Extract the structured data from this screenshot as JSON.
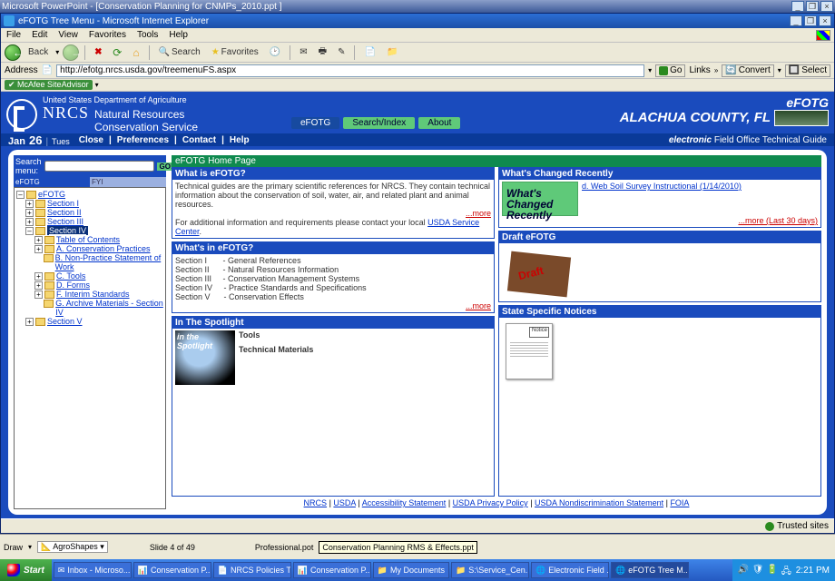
{
  "ppt_title": "Microsoft PowerPoint - [Conservation Planning for CNMPs_2010.ppt ]",
  "ie_title": "eFOTG Tree Menu - Microsoft Internet Explorer",
  "menu": [
    "File",
    "Edit",
    "View",
    "Favorites",
    "Tools",
    "Help"
  ],
  "tb": {
    "back": "Back",
    "search": "Search",
    "favorites": "Favorites"
  },
  "addr_label": "Address",
  "url": "http://efotg.nrcs.usda.gov/treemenuFS.aspx",
  "go": "Go",
  "links": "Links",
  "convert": "Convert",
  "select": "Select",
  "mcafee": "McAfee SiteAdvisor",
  "usda_line": "United States Department of Agriculture",
  "nrcs": "NRCS",
  "nrcs_sub1": "Natural Resources",
  "nrcs_sub2": "Conservation Service",
  "county": "ALACHUA COUNTY, FL",
  "efotg": "eFOTG",
  "subtitle_em": "electronic",
  "subtitle_rest": " Field Office Technical Guide",
  "month": "Jan",
  "day": "26",
  "dow": "Tues",
  "applinks": {
    "close": "Close",
    "prefs": "Preferences",
    "contact": "Contact",
    "help": "Help"
  },
  "tabs": {
    "efotg": "eFOTG",
    "search": "Search/Index",
    "about": "About"
  },
  "search_label": "Search menu:",
  "search_go": "GO!",
  "side_tabs": {
    "efotg": "eFOTG",
    "fyi": "FYI"
  },
  "tree": {
    "root": "eFOTG",
    "s1": "Section I",
    "s2": "Section II",
    "s3": "Section III",
    "s4": "Section IV",
    "toc": "Table of Contents",
    "a": "A. Conservation Practices",
    "b": "B. Non-Practice Statement of Work",
    "c": "C. Tools",
    "d": "D. Forms",
    "f": "F. Interim Standards",
    "g": "G. Archive Materials - Section IV",
    "s5": "Section V"
  },
  "page_title": "eFOTG Home Page",
  "what_is_h": "What is eFOTG?",
  "what_is_p1": "Technical guides are the primary scientific references for NRCS. They contain technical information about the conservation of soil, water, air, and related plant and animal resources.",
  "more": "...more",
  "what_is_p2a": "For additional information and requirements please contact your local ",
  "service_center": "USDA Service Center",
  "in_efotg_h": "What's in eFOTG?",
  "sections": {
    "s1": "Section I       - General References",
    "s2": "Section II      - Natural Resources Information",
    "s3": "Section III     - Conservation Management Systems",
    "s4": "Section IV     - Practice Standards and Specifications",
    "s5": "Section V      - Conservation Effects"
  },
  "spotlight_h": "In The Spotlight",
  "spot_tools": "Tools",
  "spot_tech": "Technical Materials",
  "changed_h": "What's Changed Recently",
  "changed_img1": "What's",
  "changed_img2": "Changed",
  "changed_img3": "Recently",
  "changed_link": "d. Web Soil Survey Instructional (1/14/2010)",
  "changed_more": "...more (Last 30 days)",
  "draft_h": "Draft eFOTG",
  "notices_h": "State Specific Notices",
  "footer": {
    "nrcs": "NRCS",
    "usda": "USDA",
    "acc": "Accessibility Statement",
    "priv": "USDA Privacy Policy",
    "nondis": "USDA Nondiscrimination Statement",
    "foia": "FOIA"
  },
  "status": "Trusted sites",
  "ppt": {
    "agro": "AgroShapes",
    "slide": "Slide 4 of 49",
    "file": "Professional.pot",
    "tooltip": "Conservation Planning RMS & Effects.ppt",
    "draw": "Draw"
  },
  "taskbar": {
    "start": "Start",
    "t1": "Inbox - Microso...",
    "t2": "Conservation P...",
    "t3": "NRCS Policies T...",
    "t4": "Conservation P...",
    "t5": "S:\\Service_Cen...",
    "t6": "Electronic Field ...",
    "t7": "eFOTG Tree M...",
    "t8": "My Documents"
  },
  "clock": "2:21 PM"
}
